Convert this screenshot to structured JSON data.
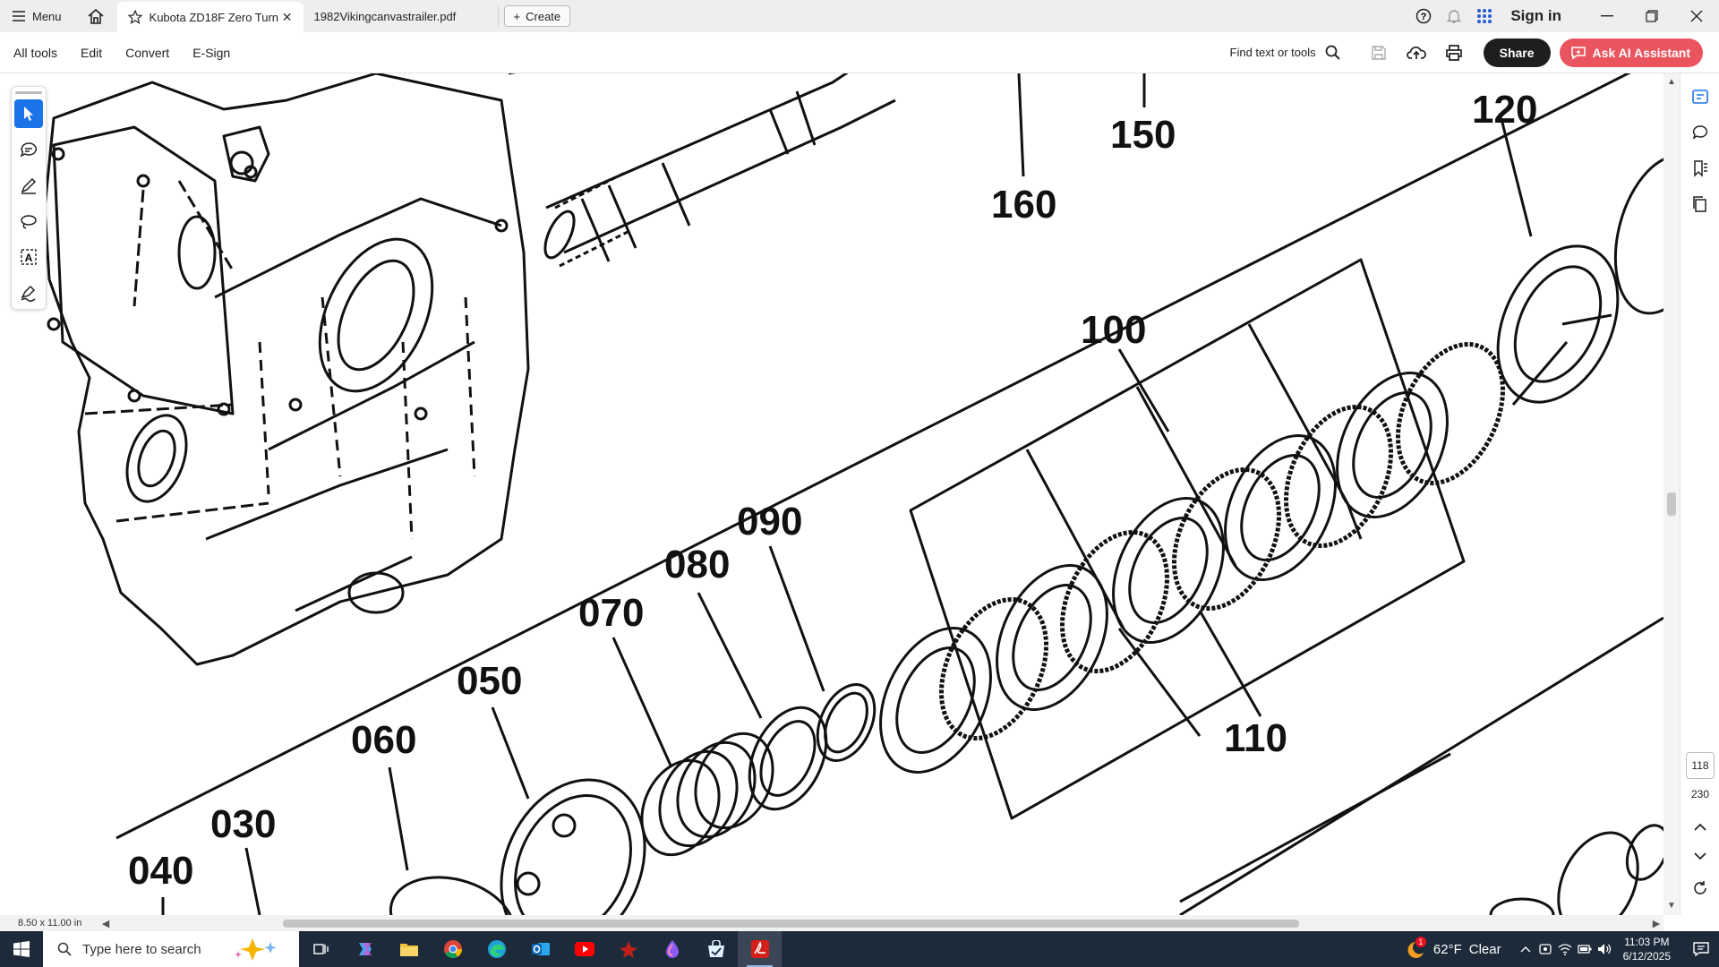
{
  "tabbar": {
    "menu_label": "Menu",
    "tabs": [
      {
        "title": "Kubota ZD18F Zero Turn ...",
        "active": true
      },
      {
        "title": "1982Vikingcanvastrailer.pdf",
        "active": false
      }
    ],
    "create_label": "Create",
    "signin_label": "Sign in"
  },
  "toolbar": {
    "menu": [
      "All tools",
      "Edit",
      "Convert",
      "E-Sign"
    ],
    "find_label": "Find text or tools",
    "share_label": "Share",
    "ai_label": "Ask AI Assistant"
  },
  "document": {
    "part_labels": [
      "150",
      "160",
      "120",
      "100",
      "090",
      "080",
      "070",
      "050",
      "060",
      "030",
      "040",
      "110"
    ]
  },
  "navigation": {
    "current_page": "118",
    "total_pages": "230",
    "page_size": "8.50 x 11.00 in"
  },
  "taskbar": {
    "search_placeholder": "Type here to search",
    "weather_temp": "62°F",
    "weather_text": "Clear",
    "weather_badge": "1",
    "time": "11:03 PM",
    "date": "6/12/2025"
  },
  "colors": {
    "accent": "#1a73e8",
    "ai_button": "#e9545f",
    "share_button": "#1e1e1e",
    "taskbar": "#1c2a3a"
  }
}
